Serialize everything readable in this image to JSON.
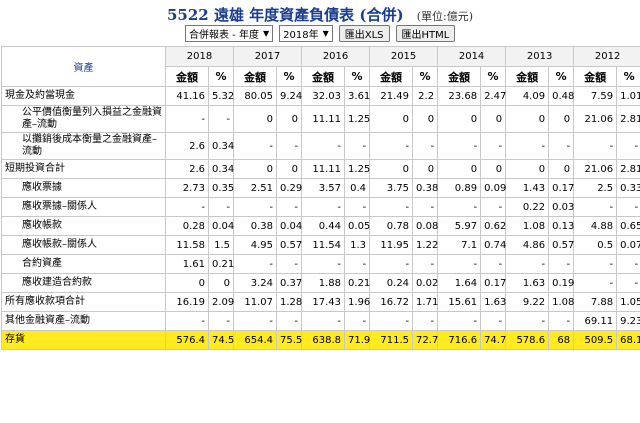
{
  "header": {
    "title": "5522 遠雄 年度資產負債表 (合併)",
    "unit": "(單位:億元)",
    "select_report": "合併報表 - 年度",
    "select_year": "2018年",
    "btn_xls": "匯出XLS",
    "btn_html": "匯出HTML"
  },
  "table": {
    "asset_label": "資產",
    "years": [
      "2018",
      "2017",
      "2016",
      "2015",
      "2014",
      "2013",
      "2012"
    ],
    "sub_amount": "金額",
    "sub_pct": "%",
    "rows": [
      {
        "label": "現金及約當現金",
        "indent": false,
        "tall": false,
        "hl": false,
        "cells": [
          "41.16",
          "5.32",
          "80.05",
          "9.24",
          "32.03",
          "3.61",
          "21.49",
          "2.2",
          "23.68",
          "2.47",
          "4.09",
          "0.48",
          "7.59",
          "1.01"
        ]
      },
      {
        "label": "公平價值衡量列入損益之金融資產–流動",
        "indent": true,
        "tall": true,
        "hl": false,
        "cells": [
          "-",
          "-",
          "0",
          "0",
          "11.11",
          "1.25",
          "0",
          "0",
          "0",
          "0",
          "0",
          "0",
          "21.06",
          "2.81"
        ]
      },
      {
        "label": "以攤銷後成本衡量之金融資產–流動",
        "indent": true,
        "tall": true,
        "hl": false,
        "cells": [
          "2.6",
          "0.34",
          "-",
          "-",
          "-",
          "-",
          "-",
          "-",
          "-",
          "-",
          "-",
          "-",
          "-",
          "-"
        ]
      },
      {
        "label": "短期投資合計",
        "indent": false,
        "tall": false,
        "hl": false,
        "cells": [
          "2.6",
          "0.34",
          "0",
          "0",
          "11.11",
          "1.25",
          "0",
          "0",
          "0",
          "0",
          "0",
          "0",
          "21.06",
          "2.81"
        ]
      },
      {
        "label": "應收票據",
        "indent": true,
        "tall": false,
        "hl": false,
        "cells": [
          "2.73",
          "0.35",
          "2.51",
          "0.29",
          "3.57",
          "0.4",
          "3.75",
          "0.38",
          "0.89",
          "0.09",
          "1.43",
          "0.17",
          "2.5",
          "0.33"
        ]
      },
      {
        "label": "應收票據–關係人",
        "indent": true,
        "tall": false,
        "hl": false,
        "cells": [
          "-",
          "-",
          "-",
          "-",
          "-",
          "-",
          "-",
          "-",
          "-",
          "-",
          "0.22",
          "0.03",
          "-",
          "-"
        ]
      },
      {
        "label": "應收帳款",
        "indent": true,
        "tall": false,
        "hl": false,
        "cells": [
          "0.28",
          "0.04",
          "0.38",
          "0.04",
          "0.44",
          "0.05",
          "0.78",
          "0.08",
          "5.97",
          "0.62",
          "1.08",
          "0.13",
          "4.88",
          "0.65"
        ]
      },
      {
        "label": "應收帳款–關係人",
        "indent": true,
        "tall": false,
        "hl": false,
        "cells": [
          "11.58",
          "1.5",
          "4.95",
          "0.57",
          "11.54",
          "1.3",
          "11.95",
          "1.22",
          "7.1",
          "0.74",
          "4.86",
          "0.57",
          "0.5",
          "0.07"
        ]
      },
      {
        "label": "合約資產",
        "indent": true,
        "tall": false,
        "hl": false,
        "cells": [
          "1.61",
          "0.21",
          "-",
          "-",
          "-",
          "-",
          "-",
          "-",
          "-",
          "-",
          "-",
          "-",
          "-",
          "-"
        ]
      },
      {
        "label": "應收建造合約款",
        "indent": true,
        "tall": false,
        "hl": false,
        "cells": [
          "0",
          "0",
          "3.24",
          "0.37",
          "1.88",
          "0.21",
          "0.24",
          "0.02",
          "1.64",
          "0.17",
          "1.63",
          "0.19",
          "-",
          "-"
        ]
      },
      {
        "label": "所有應收款項合計",
        "indent": false,
        "tall": false,
        "hl": false,
        "cells": [
          "16.19",
          "2.09",
          "11.07",
          "1.28",
          "17.43",
          "1.96",
          "16.72",
          "1.71",
          "15.61",
          "1.63",
          "9.22",
          "1.08",
          "7.88",
          "1.05"
        ]
      },
      {
        "label": "其他金融資產–流動",
        "indent": false,
        "tall": false,
        "hl": false,
        "cells": [
          "-",
          "-",
          "-",
          "-",
          "-",
          "-",
          "-",
          "-",
          "-",
          "-",
          "-",
          "-",
          "69.11",
          "9.23"
        ]
      },
      {
        "label": "存貨",
        "indent": false,
        "tall": false,
        "hl": true,
        "cells": [
          "576.4",
          "74.5",
          "654.4",
          "75.5",
          "638.8",
          "71.9",
          "711.5",
          "72.7",
          "716.6",
          "74.7",
          "578.6",
          "68",
          "509.5",
          "68.1"
        ]
      }
    ]
  }
}
